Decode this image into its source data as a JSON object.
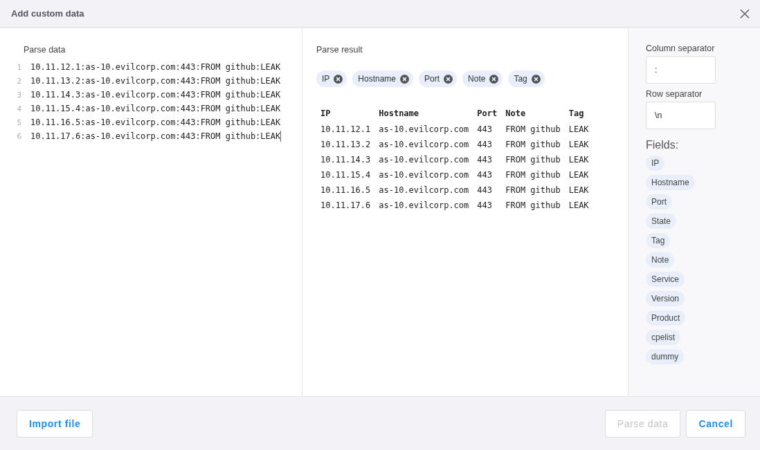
{
  "dialog": {
    "title": "Add custom data"
  },
  "parse_data": {
    "label": "Parse data",
    "lines": [
      {
        "number": "1",
        "text": "10.11.12.1:as-10.evilcorp.com:443:FROM github:LEAK"
      },
      {
        "number": "2",
        "text": "10.11.13.2:as-10.evilcorp.com:443:FROM github:LEAK"
      },
      {
        "number": "3",
        "text": "10.11.14.3:as-10.evilcorp.com:443:FROM github:LEAK"
      },
      {
        "number": "4",
        "text": "10.11.15.4:as-10.evilcorp.com:443:FROM github:LEAK"
      },
      {
        "number": "5",
        "text": "10.11.16.5:as-10.evilcorp.com:443:FROM github:LEAK"
      },
      {
        "number": "6",
        "text": "10.11.17.6:as-10.evilcorp.com:443:FROM github:LEAK"
      }
    ]
  },
  "parse_result": {
    "label": "Parse result",
    "chips": [
      "IP",
      "Hostname",
      "Port",
      "Note",
      "Tag"
    ],
    "table": {
      "columns": [
        "IP",
        "Hostname",
        "Port",
        "Note",
        "Tag"
      ],
      "rows": [
        [
          "10.11.12.1",
          "as-10.evilcorp.com",
          "443",
          "FROM github",
          "LEAK"
        ],
        [
          "10.11.13.2",
          "as-10.evilcorp.com",
          "443",
          "FROM github",
          "LEAK"
        ],
        [
          "10.11.14.3",
          "as-10.evilcorp.com",
          "443",
          "FROM github",
          "LEAK"
        ],
        [
          "10.11.15.4",
          "as-10.evilcorp.com",
          "443",
          "FROM github",
          "LEAK"
        ],
        [
          "10.11.16.5",
          "as-10.evilcorp.com",
          "443",
          "FROM github",
          "LEAK"
        ],
        [
          "10.11.17.6",
          "as-10.evilcorp.com",
          "443",
          "FROM github",
          "LEAK"
        ]
      ]
    }
  },
  "settings": {
    "column_separator": {
      "label": "Column separator",
      "value": ":"
    },
    "row_separator": {
      "label": "Row separator",
      "value": "\\n"
    },
    "fields_label": "Fields:",
    "fields": [
      "IP",
      "Hostname",
      "Port",
      "State",
      "Tag",
      "Note",
      "Service",
      "Version",
      "Product",
      "cpelist",
      "dummy"
    ]
  },
  "footer": {
    "left_buttons": [
      {
        "label": "Import file",
        "disabled": false
      }
    ],
    "right_buttons": [
      {
        "label": "Parse data",
        "disabled": true
      },
      {
        "label": "Cancel",
        "disabled": false
      }
    ]
  }
}
